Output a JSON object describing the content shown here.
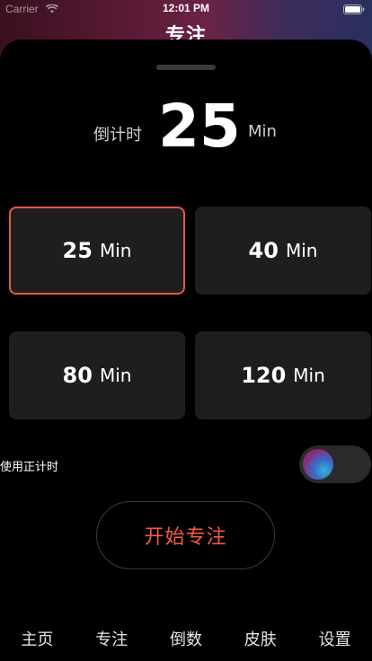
{
  "status_bar": {
    "carrier": "Carrier",
    "time": "12:01 PM"
  },
  "nav": {
    "title": "专注"
  },
  "countdown": {
    "label": "倒计时",
    "value": "25",
    "unit": "Min"
  },
  "options": [
    {
      "value": "25",
      "unit": "Min",
      "selected": true
    },
    {
      "value": "40",
      "unit": "Min",
      "selected": false
    },
    {
      "value": "80",
      "unit": "Min",
      "selected": false
    },
    {
      "value": "120",
      "unit": "Min",
      "selected": false
    }
  ],
  "toggle": {
    "label": "使用正计时"
  },
  "start_button": {
    "label": "开始专注"
  },
  "tab_bar": {
    "items": [
      "主页",
      "专注",
      "倒数",
      "皮肤",
      "设置"
    ]
  },
  "colors": {
    "accent": "#f05a45",
    "selected_border": "#e6574a",
    "card_bg": "#1e1e1e"
  }
}
